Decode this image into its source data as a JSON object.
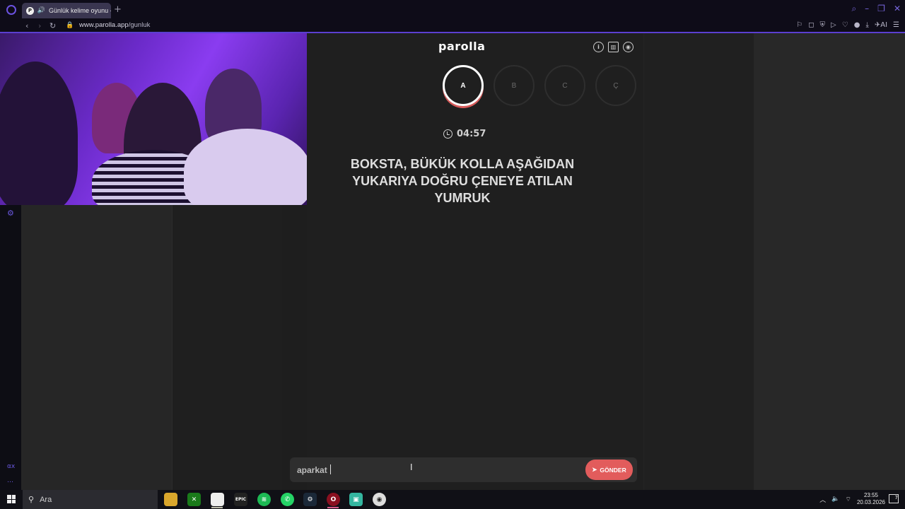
{
  "browser": {
    "tab_title": "Günlük kelime oyunu -",
    "url_host": "www.parolla.app",
    "url_path": "/gunluk"
  },
  "app": {
    "logo": "parolla",
    "letters": [
      "A",
      "B",
      "C",
      "Ç"
    ],
    "active_letter_index": 0,
    "timer": "04:57",
    "question": "BOKSTA, BÜKÜK KOLLA AŞAĞIDAN YUKARIYA DOĞRU ÇENEYE ATILAN YUMRUK",
    "answer_value": "aparkat",
    "send_label": "GÖNDER"
  },
  "sidebar": {
    "bottom_label": "αx"
  },
  "taskbar": {
    "search_placeholder": "Ara",
    "time": "23:55",
    "date": "20.03.2026",
    "notification_count": "7"
  },
  "colors": {
    "accent": "#e25c5c",
    "browser_accent": "#5b3fd0"
  }
}
